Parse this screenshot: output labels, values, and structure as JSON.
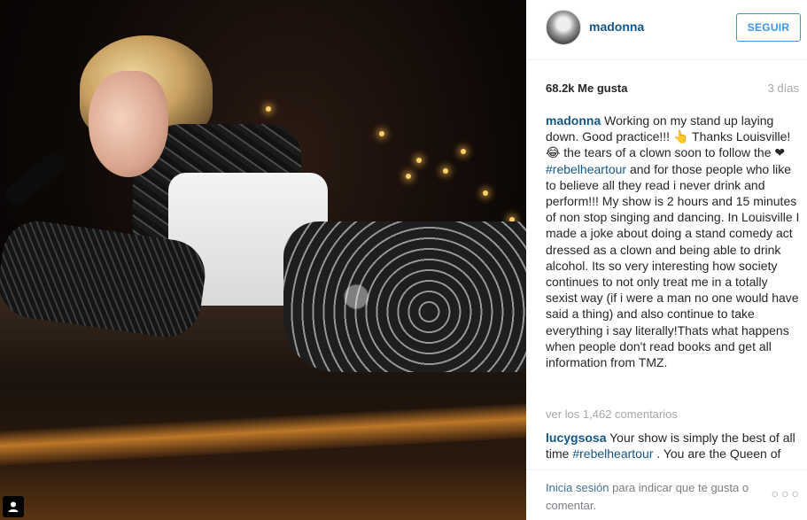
{
  "post": {
    "username": "madonna",
    "follow_label": "SEGUIR",
    "likes": "68.2k Me gusta",
    "age": "3 días",
    "caption": {
      "user": "madonna",
      "part1": "Working on my stand up laying down. Good practice!!! 👆 Thanks Louisville! 😂 the tears of a clown soon to follow the ❤",
      "tag": "#rebelheartour",
      "part2": " and for those people who like to believe all they read i never drink and perform!!! My show is 2 hours and 15 minutes of non stop singing and dancing. In Louisville I made a joke about doing a stand comedy act dressed as a clown and being able to drink alcohol. Its so very interesting how society continues to not only treat me in a totally sexist way (if i were a man no one would have said a thing) and also continue to take everything i say literally!Thats what happens when people don't read books and get all information from TMZ."
    },
    "view_all": "ver los 1,462 comentarios",
    "comment": {
      "user": "lucygsosa",
      "part1": "Your show is simply the best of all time ",
      "tag": "#rebelheartour",
      "part2": " . You are the Queen of Queens"
    },
    "footer": {
      "login_link": "Inicia sesión",
      "login_rest": " para indicar que te gusta o comentar.",
      "more_label": "○○○"
    },
    "photo_badge_icon": "user-icon"
  }
}
